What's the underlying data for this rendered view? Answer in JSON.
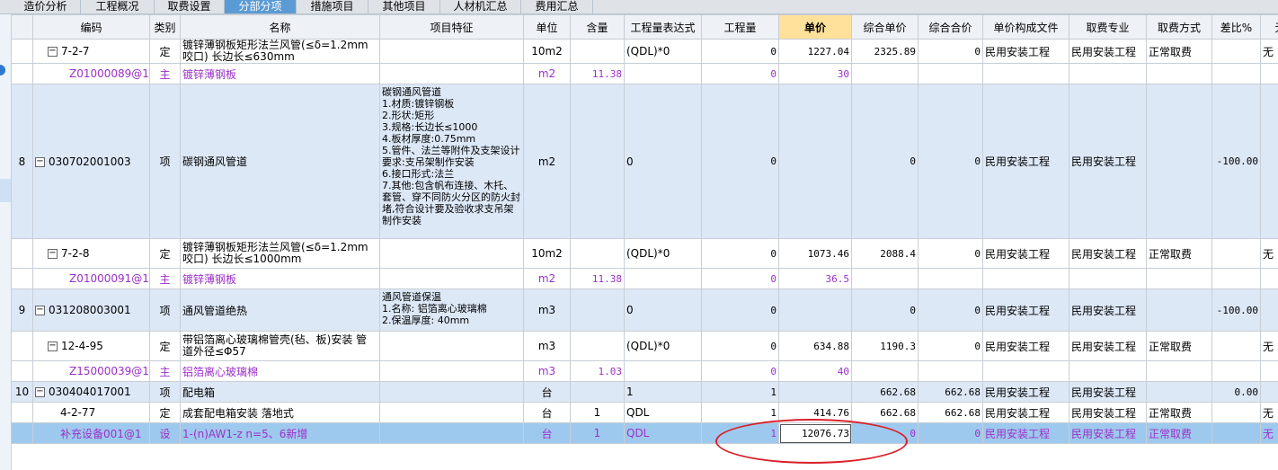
{
  "tabs": [
    {
      "label": "造价分析"
    },
    {
      "label": "工程概况"
    },
    {
      "label": "取费设置"
    },
    {
      "label": "分部分项",
      "active": true
    },
    {
      "label": "措施项目"
    },
    {
      "label": "其他项目"
    },
    {
      "label": "人材机汇总"
    },
    {
      "label": "费用汇总"
    }
  ],
  "columns": [
    "编码",
    "类别",
    "名称",
    "项目特征",
    "单位",
    "含量",
    "工程量表达式",
    "工程量",
    "单价",
    "综合单价",
    "综合合价",
    "单价构成文件",
    "取费专业",
    "取费方式",
    "差比%",
    "无"
  ],
  "rows": [
    {
      "seq": "",
      "code": "7-2-7",
      "type": "定",
      "name": "镀锌薄钢板矩形法兰风管(≤δ=1.2mm咬口) 长边长≤630mm",
      "feature": "",
      "unit": "10m2",
      "content": "",
      "expr": "(QDL)*0",
      "qty": "0",
      "price": "1227.04",
      "comp_price": "2325.89",
      "comp_total": "0",
      "file": "民用安装工程",
      "spec": "民用安装工程",
      "mode": "正常取费",
      "diff": "",
      "extra": "无"
    },
    {
      "seq": "",
      "code": "Z01000089@1",
      "type": "主",
      "name": "镀锌薄钢板",
      "feature": "",
      "unit": "m2",
      "content": "11.38",
      "expr": "",
      "qty": "0",
      "price": "30",
      "comp_price": "",
      "comp_total": "",
      "file": "",
      "spec": "",
      "mode": "",
      "diff": "",
      "extra": ""
    },
    {
      "seq": "8",
      "code": "030702001003",
      "type": "项",
      "name": "碳钢通风管道",
      "feature": "碳钢通风管道\n1.材质:镀锌钢板\n2.形状:矩形\n3.规格:长边长≤1000\n4.板材厚度:0.75mm\n5.管件、法兰等附件及支架设计要求:支吊架制作安装\n6.接口形式:法兰\n7.其他:包含帆布连接、木托、套管、穿不同防火分区的防火封堵,符合设计要及验收求支吊架制作安装",
      "unit": "m2",
      "content": "",
      "expr": "0",
      "qty": "0",
      "price": "",
      "comp_price": "0",
      "comp_total": "0",
      "file": "民用安装工程",
      "spec": "民用安装工程",
      "mode": "",
      "diff": "-100.00",
      "extra": ""
    },
    {
      "seq": "",
      "code": "7-2-8",
      "type": "定",
      "name": "镀锌薄钢板矩形法兰风管(≤δ=1.2mm咬口) 长边长≤1000mm",
      "feature": "",
      "unit": "10m2",
      "content": "",
      "expr": "(QDL)*0",
      "qty": "0",
      "price": "1073.46",
      "comp_price": "2088.4",
      "comp_total": "0",
      "file": "民用安装工程",
      "spec": "民用安装工程",
      "mode": "正常取费",
      "diff": "",
      "extra": "无"
    },
    {
      "seq": "",
      "code": "Z01000091@1",
      "type": "主",
      "name": "镀锌薄钢板",
      "feature": "",
      "unit": "m2",
      "content": "11.38",
      "expr": "",
      "qty": "0",
      "price": "36.5",
      "comp_price": "",
      "comp_total": "",
      "file": "",
      "spec": "",
      "mode": "",
      "diff": "",
      "extra": ""
    },
    {
      "seq": "9",
      "code": "031208003001",
      "type": "项",
      "name": "通风管道绝热",
      "feature": "通风管道保温\n1.名称: 铝箔离心玻璃棉\n2.保温厚度: 40mm",
      "unit": "m3",
      "content": "",
      "expr": "0",
      "qty": "0",
      "price": "",
      "comp_price": "0",
      "comp_total": "0",
      "file": "民用安装工程",
      "spec": "民用安装工程",
      "mode": "",
      "diff": "-100.00",
      "extra": ""
    },
    {
      "seq": "",
      "code": "12-4-95",
      "type": "定",
      "name": "带铝箔离心玻璃棉管壳(毡、板)安装 管道外径≤Φ57",
      "feature": "",
      "unit": "m3",
      "content": "",
      "expr": "(QDL)*0",
      "qty": "0",
      "price": "634.88",
      "comp_price": "1190.3",
      "comp_total": "0",
      "file": "民用安装工程",
      "spec": "民用安装工程",
      "mode": "正常取费",
      "diff": "",
      "extra": "无"
    },
    {
      "seq": "",
      "code": "Z15000039@1",
      "type": "主",
      "name": "铝箔离心玻璃棉",
      "feature": "",
      "unit": "m3",
      "content": "1.03",
      "expr": "",
      "qty": "0",
      "price": "40",
      "comp_price": "",
      "comp_total": "",
      "file": "",
      "spec": "",
      "mode": "",
      "diff": "",
      "extra": ""
    },
    {
      "seq": "10",
      "code": "030404017001",
      "type": "项",
      "name": "配电箱",
      "feature": "",
      "unit": "台",
      "content": "",
      "expr": "1",
      "qty": "1",
      "price": "",
      "comp_price": "662.68",
      "comp_total": "662.68",
      "file": "民用安装工程",
      "spec": "民用安装工程",
      "mode": "",
      "diff": "0.00",
      "extra": ""
    },
    {
      "seq": "",
      "code": "4-2-77",
      "type": "定",
      "name": "成套配电箱安装 落地式",
      "feature": "",
      "unit": "台",
      "content": "1",
      "expr": "QDL",
      "qty": "1",
      "price": "414.76",
      "comp_price": "662.68",
      "comp_total": "662.68",
      "file": "民用安装工程",
      "spec": "民用安装工程",
      "mode": "正常取费",
      "diff": "",
      "extra": "无"
    },
    {
      "seq": "",
      "code": "补充设备001@1",
      "type": "设",
      "name": "1-(n)AW1-z n=5、6新增",
      "feature": "",
      "unit": "台",
      "content": "1",
      "expr": "QDL",
      "qty": "1",
      "price": "12076.73",
      "comp_price": "0",
      "comp_total": "0",
      "file": "民用安装工程",
      "spec": "民用安装工程",
      "mode": "正常取费",
      "diff": "",
      "extra": "无"
    }
  ]
}
